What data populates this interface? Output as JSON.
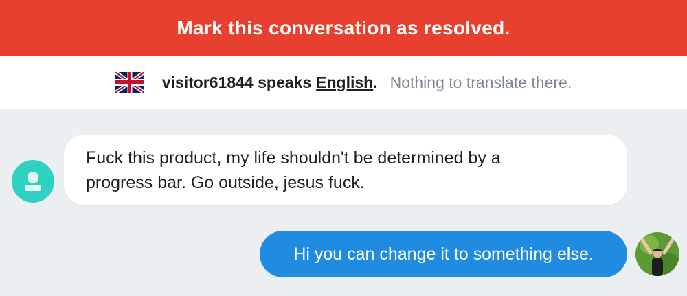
{
  "banner": {
    "label": "Mark this conversation as resolved."
  },
  "language_bar": {
    "speaker_text": "visitor61844 speaks",
    "language": "English",
    "period": ".",
    "note": "Nothing to translate there.",
    "flag_icon": "uk-flag-icon"
  },
  "messages": [
    {
      "from": "visitor",
      "text_line1": "Fuck this product, my life shouldn't be determined by a",
      "text_line2": "progress bar. Go outside, jesus fuck."
    },
    {
      "from": "agent",
      "text": "Hi you can change it to something else."
    }
  ],
  "colors": {
    "banner": "#e8402f",
    "agent_bubble": "#1f8be1",
    "visitor_avatar": "#2fd2c0",
    "background": "#eceff2"
  }
}
